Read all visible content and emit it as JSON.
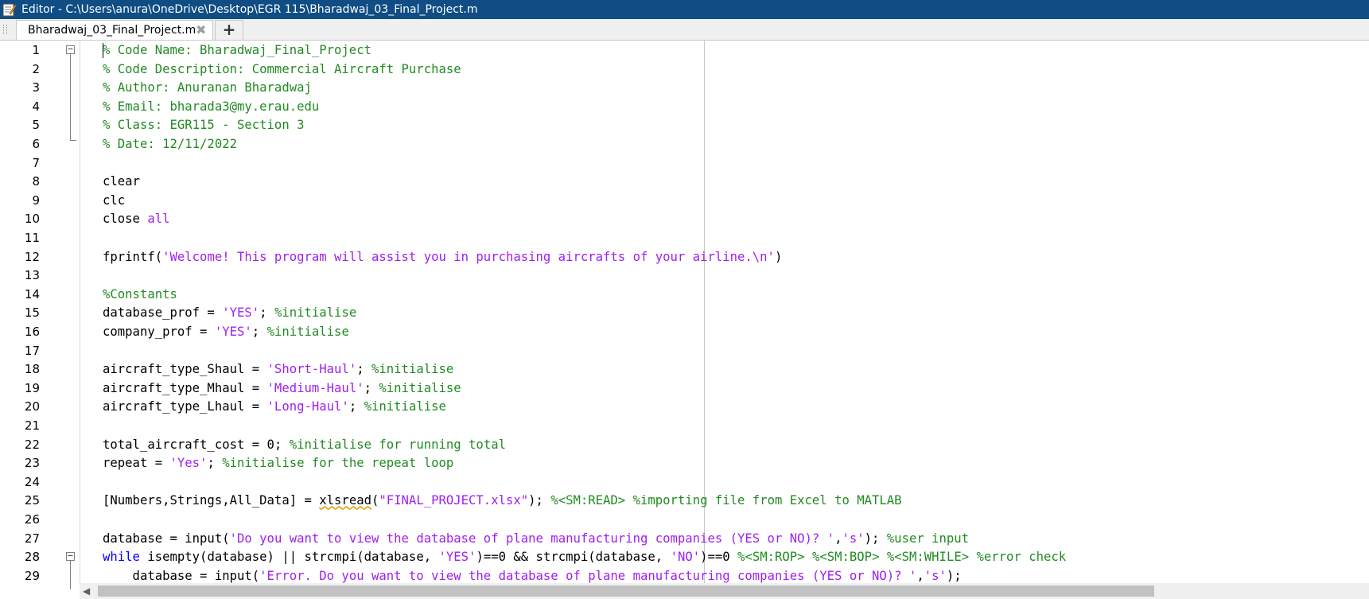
{
  "window": {
    "title": "Editor - C:\\Users\\anura\\OneDrive\\Desktop\\EGR 115\\Bharadwaj_03_Final_Project.m"
  },
  "tabs": [
    {
      "label": "Bharadwaj_03_Final_Project.m",
      "close_icon": "close-icon"
    }
  ],
  "add_tab_label": "+",
  "colors": {
    "titlebar": "#0f4d84",
    "comment": "#228b22",
    "string": "#a020f0",
    "keyword": "#0000ff"
  },
  "code_lines": [
    {
      "n": "1",
      "segs": [
        [
          "c",
          "% Code Name: Bharadwaj_Final_Project"
        ]
      ]
    },
    {
      "n": "2",
      "segs": [
        [
          "c",
          "% Code Description: Commercial Aircraft Purchase"
        ]
      ]
    },
    {
      "n": "3",
      "segs": [
        [
          "c",
          "% Author: Anuranan Bharadwaj"
        ]
      ]
    },
    {
      "n": "4",
      "segs": [
        [
          "c",
          "% Email: bharada3@my.erau.edu"
        ]
      ]
    },
    {
      "n": "5",
      "segs": [
        [
          "c",
          "% Class: EGR115 - Section 3"
        ]
      ]
    },
    {
      "n": "6",
      "segs": [
        [
          "c",
          "% Date: 12/11/2022"
        ]
      ]
    },
    {
      "n": "7",
      "segs": []
    },
    {
      "n": "8",
      "segs": [
        [
          "t",
          "clear"
        ]
      ]
    },
    {
      "n": "9",
      "segs": [
        [
          "t",
          "clc"
        ]
      ]
    },
    {
      "n": "10",
      "segs": [
        [
          "t",
          "close "
        ],
        [
          "s",
          "all"
        ]
      ]
    },
    {
      "n": "11",
      "segs": []
    },
    {
      "n": "12",
      "segs": [
        [
          "t",
          "fprintf("
        ],
        [
          "s",
          "'Welcome! This program will assist you in purchasing aircrafts of your airline.\\n'"
        ],
        [
          "t",
          ")"
        ]
      ]
    },
    {
      "n": "13",
      "segs": []
    },
    {
      "n": "14",
      "segs": [
        [
          "c",
          "%Constants"
        ]
      ]
    },
    {
      "n": "15",
      "segs": [
        [
          "t",
          "database_prof = "
        ],
        [
          "s",
          "'YES'"
        ],
        [
          "t",
          "; "
        ],
        [
          "c",
          "%initialise"
        ]
      ]
    },
    {
      "n": "16",
      "segs": [
        [
          "t",
          "company_prof = "
        ],
        [
          "s",
          "'YES'"
        ],
        [
          "t",
          "; "
        ],
        [
          "c",
          "%initialise"
        ]
      ]
    },
    {
      "n": "17",
      "segs": []
    },
    {
      "n": "18",
      "segs": [
        [
          "t",
          "aircraft_type_Shaul = "
        ],
        [
          "s",
          "'Short-Haul'"
        ],
        [
          "t",
          "; "
        ],
        [
          "c",
          "%initialise"
        ]
      ]
    },
    {
      "n": "19",
      "segs": [
        [
          "t",
          "aircraft_type_Mhaul = "
        ],
        [
          "s",
          "'Medium-Haul'"
        ],
        [
          "t",
          "; "
        ],
        [
          "c",
          "%initialise"
        ]
      ]
    },
    {
      "n": "20",
      "segs": [
        [
          "t",
          "aircraft_type_Lhaul = "
        ],
        [
          "s",
          "'Long-Haul'"
        ],
        [
          "t",
          "; "
        ],
        [
          "c",
          "%initialise"
        ]
      ]
    },
    {
      "n": "21",
      "segs": []
    },
    {
      "n": "22",
      "segs": [
        [
          "t",
          "total_aircraft_cost = 0; "
        ],
        [
          "c",
          "%initialise for running total"
        ]
      ]
    },
    {
      "n": "23",
      "segs": [
        [
          "t",
          "repeat = "
        ],
        [
          "s",
          "'Yes'"
        ],
        [
          "t",
          "; "
        ],
        [
          "c",
          "%initialise for the repeat loop"
        ]
      ]
    },
    {
      "n": "24",
      "segs": []
    },
    {
      "n": "25",
      "segs": [
        [
          "t",
          "[Numbers,Strings,All_Data] = "
        ],
        [
          "w",
          "xlsread"
        ],
        [
          "t",
          "("
        ],
        [
          "s",
          "\"FINAL_PROJECT.xlsx\""
        ],
        [
          "t",
          "); "
        ],
        [
          "c",
          "%<SM:READ> %importing file from Excel to MATLAB"
        ]
      ]
    },
    {
      "n": "26",
      "segs": []
    },
    {
      "n": "27",
      "segs": [
        [
          "t",
          "database = input("
        ],
        [
          "s",
          "'Do you want to view the database of plane manufacturing companies (YES or NO)? '"
        ],
        [
          "t",
          ","
        ],
        [
          "s",
          "'s'"
        ],
        [
          "t",
          "); "
        ],
        [
          "c",
          "%user input"
        ]
      ]
    },
    {
      "n": "28",
      "segs": [
        [
          "k",
          "while "
        ],
        [
          "t",
          "isempty(database) || strcmpi(database, "
        ],
        [
          "s",
          "'YES'"
        ],
        [
          "t",
          ")==0 && strcmpi(database, "
        ],
        [
          "s",
          "'NO'"
        ],
        [
          "t",
          ")==0 "
        ],
        [
          "c",
          "%<SM:ROP> %<SM:BOP> %<SM:WHILE> %error check"
        ]
      ]
    },
    {
      "n": "29",
      "segs": [
        [
          "t",
          "    database = input("
        ],
        [
          "s",
          "'Error. Do you want to view the database of plane manufacturing companies (YES or NO)? '"
        ],
        [
          "t",
          ","
        ],
        [
          "s",
          "'s'"
        ],
        [
          "t",
          ");"
        ]
      ]
    }
  ]
}
